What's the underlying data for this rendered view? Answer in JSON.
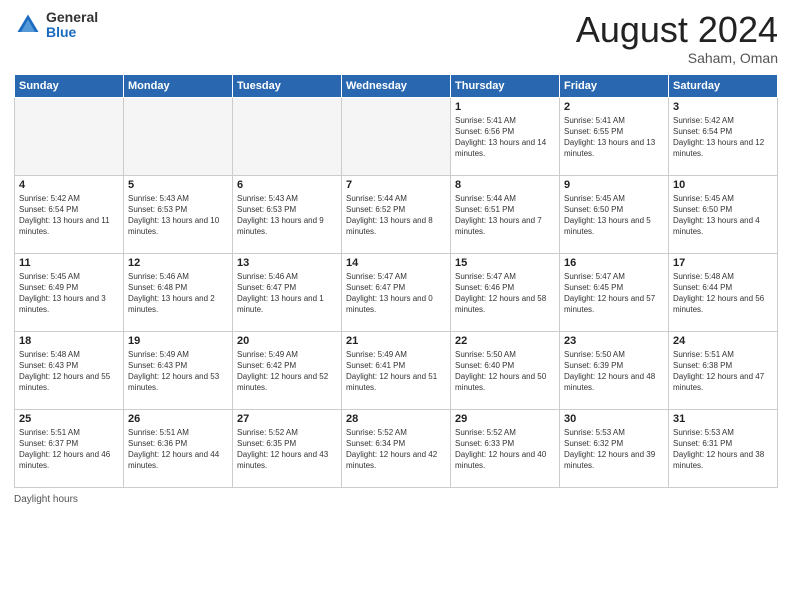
{
  "logo": {
    "general": "General",
    "blue": "Blue"
  },
  "title": {
    "month": "August 2024",
    "location": "Saham, Oman"
  },
  "weekdays": [
    "Sunday",
    "Monday",
    "Tuesday",
    "Wednesday",
    "Thursday",
    "Friday",
    "Saturday"
  ],
  "weeks": [
    [
      {
        "day": "",
        "info": ""
      },
      {
        "day": "",
        "info": ""
      },
      {
        "day": "",
        "info": ""
      },
      {
        "day": "",
        "info": ""
      },
      {
        "day": "1",
        "info": "Sunrise: 5:41 AM\nSunset: 6:56 PM\nDaylight: 13 hours and 14 minutes."
      },
      {
        "day": "2",
        "info": "Sunrise: 5:41 AM\nSunset: 6:55 PM\nDaylight: 13 hours and 13 minutes."
      },
      {
        "day": "3",
        "info": "Sunrise: 5:42 AM\nSunset: 6:54 PM\nDaylight: 13 hours and 12 minutes."
      }
    ],
    [
      {
        "day": "4",
        "info": "Sunrise: 5:42 AM\nSunset: 6:54 PM\nDaylight: 13 hours and 11 minutes."
      },
      {
        "day": "5",
        "info": "Sunrise: 5:43 AM\nSunset: 6:53 PM\nDaylight: 13 hours and 10 minutes."
      },
      {
        "day": "6",
        "info": "Sunrise: 5:43 AM\nSunset: 6:53 PM\nDaylight: 13 hours and 9 minutes."
      },
      {
        "day": "7",
        "info": "Sunrise: 5:44 AM\nSunset: 6:52 PM\nDaylight: 13 hours and 8 minutes."
      },
      {
        "day": "8",
        "info": "Sunrise: 5:44 AM\nSunset: 6:51 PM\nDaylight: 13 hours and 7 minutes."
      },
      {
        "day": "9",
        "info": "Sunrise: 5:45 AM\nSunset: 6:50 PM\nDaylight: 13 hours and 5 minutes."
      },
      {
        "day": "10",
        "info": "Sunrise: 5:45 AM\nSunset: 6:50 PM\nDaylight: 13 hours and 4 minutes."
      }
    ],
    [
      {
        "day": "11",
        "info": "Sunrise: 5:45 AM\nSunset: 6:49 PM\nDaylight: 13 hours and 3 minutes."
      },
      {
        "day": "12",
        "info": "Sunrise: 5:46 AM\nSunset: 6:48 PM\nDaylight: 13 hours and 2 minutes."
      },
      {
        "day": "13",
        "info": "Sunrise: 5:46 AM\nSunset: 6:47 PM\nDaylight: 13 hours and 1 minute."
      },
      {
        "day": "14",
        "info": "Sunrise: 5:47 AM\nSunset: 6:47 PM\nDaylight: 13 hours and 0 minutes."
      },
      {
        "day": "15",
        "info": "Sunrise: 5:47 AM\nSunset: 6:46 PM\nDaylight: 12 hours and 58 minutes."
      },
      {
        "day": "16",
        "info": "Sunrise: 5:47 AM\nSunset: 6:45 PM\nDaylight: 12 hours and 57 minutes."
      },
      {
        "day": "17",
        "info": "Sunrise: 5:48 AM\nSunset: 6:44 PM\nDaylight: 12 hours and 56 minutes."
      }
    ],
    [
      {
        "day": "18",
        "info": "Sunrise: 5:48 AM\nSunset: 6:43 PM\nDaylight: 12 hours and 55 minutes."
      },
      {
        "day": "19",
        "info": "Sunrise: 5:49 AM\nSunset: 6:43 PM\nDaylight: 12 hours and 53 minutes."
      },
      {
        "day": "20",
        "info": "Sunrise: 5:49 AM\nSunset: 6:42 PM\nDaylight: 12 hours and 52 minutes."
      },
      {
        "day": "21",
        "info": "Sunrise: 5:49 AM\nSunset: 6:41 PM\nDaylight: 12 hours and 51 minutes."
      },
      {
        "day": "22",
        "info": "Sunrise: 5:50 AM\nSunset: 6:40 PM\nDaylight: 12 hours and 50 minutes."
      },
      {
        "day": "23",
        "info": "Sunrise: 5:50 AM\nSunset: 6:39 PM\nDaylight: 12 hours and 48 minutes."
      },
      {
        "day": "24",
        "info": "Sunrise: 5:51 AM\nSunset: 6:38 PM\nDaylight: 12 hours and 47 minutes."
      }
    ],
    [
      {
        "day": "25",
        "info": "Sunrise: 5:51 AM\nSunset: 6:37 PM\nDaylight: 12 hours and 46 minutes."
      },
      {
        "day": "26",
        "info": "Sunrise: 5:51 AM\nSunset: 6:36 PM\nDaylight: 12 hours and 44 minutes."
      },
      {
        "day": "27",
        "info": "Sunrise: 5:52 AM\nSunset: 6:35 PM\nDaylight: 12 hours and 43 minutes."
      },
      {
        "day": "28",
        "info": "Sunrise: 5:52 AM\nSunset: 6:34 PM\nDaylight: 12 hours and 42 minutes."
      },
      {
        "day": "29",
        "info": "Sunrise: 5:52 AM\nSunset: 6:33 PM\nDaylight: 12 hours and 40 minutes."
      },
      {
        "day": "30",
        "info": "Sunrise: 5:53 AM\nSunset: 6:32 PM\nDaylight: 12 hours and 39 minutes."
      },
      {
        "day": "31",
        "info": "Sunrise: 5:53 AM\nSunset: 6:31 PM\nDaylight: 12 hours and 38 minutes."
      }
    ]
  ],
  "footer": {
    "daylight_label": "Daylight hours"
  }
}
